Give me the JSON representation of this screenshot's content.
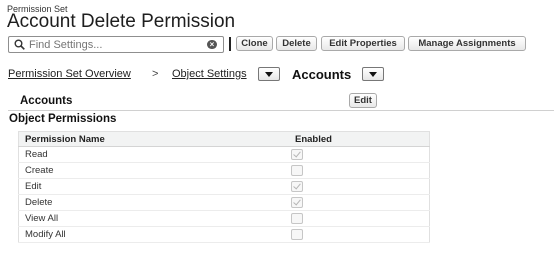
{
  "header": {
    "supertitle": "Permission Set",
    "title": "Account Delete Permission"
  },
  "toolbar": {
    "search_placeholder": "Find Settings...",
    "buttons": [
      "Clone",
      "Delete",
      "Edit Properties",
      "Manage Assignments"
    ]
  },
  "breadcrumb": {
    "overview": "Permission Set Overview",
    "separator": ">",
    "object_settings": "Object Settings",
    "current": "Accounts"
  },
  "section": {
    "title": "Accounts",
    "edit_label": "Edit",
    "subsection_title": "Object Permissions"
  },
  "table": {
    "columns": [
      "Permission Name",
      "Enabled"
    ],
    "rows": [
      {
        "name": "Read",
        "enabled": true
      },
      {
        "name": "Create",
        "enabled": false
      },
      {
        "name": "Edit",
        "enabled": true
      },
      {
        "name": "Delete",
        "enabled": true
      },
      {
        "name": "View All",
        "enabled": false
      },
      {
        "name": "Modify All",
        "enabled": false
      }
    ]
  }
}
